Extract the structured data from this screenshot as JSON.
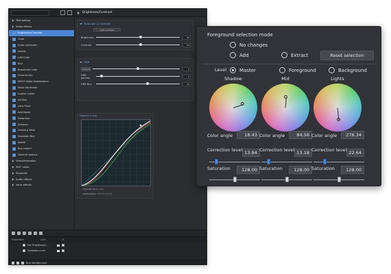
{
  "sidebar": {
    "items": [
      {
        "label": "Title editing",
        "icon": "arrow",
        "selected": false
      },
      {
        "label": "Video effects",
        "icon": "arrow",
        "selected": false
      },
      {
        "label": "Brightness/Contrast",
        "icon": "fx",
        "selected": true
      },
      {
        "label": "Color",
        "icon": "fx",
        "selected": false
      },
      {
        "label": "Color correction",
        "icon": "fx",
        "selected": false
      },
      {
        "label": "Levels",
        "icon": "fx",
        "selected": false
      },
      {
        "label": "LAB Color",
        "icon": "fx",
        "selected": false
      },
      {
        "label": "Blur",
        "icon": "fx",
        "selected": false
      },
      {
        "label": "Broadcast Color",
        "icon": "fx",
        "selected": false
      },
      {
        "label": "Chroma key",
        "icon": "fx",
        "selected": false
      },
      {
        "label": "MSU3 Video Stabilization",
        "icon": "fx",
        "selected": false
      },
      {
        "label": "Mask Generator",
        "icon": "fx",
        "selected": false
      },
      {
        "label": "Cookie Cutter",
        "icon": "fx",
        "selected": false
      },
      {
        "label": "Art Blur",
        "icon": "fx",
        "selected": false
      },
      {
        "label": "Lens Flare",
        "icon": "fx",
        "selected": false
      },
      {
        "label": "Add Noise",
        "icon": "fx",
        "selected": false
      },
      {
        "label": "Distortion",
        "icon": "fx",
        "selected": false
      },
      {
        "label": "Sharpen",
        "icon": "fx",
        "selected": false
      },
      {
        "label": "Unsharp Mask",
        "icon": "fx",
        "selected": false
      },
      {
        "label": "Gaussian Blur",
        "icon": "fx",
        "selected": false
      },
      {
        "label": "Speed",
        "icon": "fx",
        "selected": false
      },
      {
        "label": "Blur match",
        "icon": "fx",
        "selected": false
      },
      {
        "label": "General options",
        "icon": "fx",
        "selected": false
      },
      {
        "label": "Video/Animation",
        "icon": "arrow",
        "selected": false
      },
      {
        "label": "360° video",
        "icon": "arrow",
        "selected": false
      },
      {
        "label": "Stereo3D",
        "icon": "arrow",
        "selected": false
      },
      {
        "label": "Audio effects",
        "icon": "arrow",
        "selected": false
      },
      {
        "label": "Voice effects",
        "icon": "arrow",
        "selected": false
      }
    ]
  },
  "right_panel": {
    "header": "Brightness/Contrast",
    "group1": {
      "title": "Tint/Light & Contrast",
      "auto_button": "Auto contrast",
      "rows": [
        {
          "label": "Brightness",
          "value": "50",
          "level": 0.52
        },
        {
          "label": "Contrast",
          "value": "50",
          "level": 0.52
        }
      ]
    },
    "group2": {
      "title": "HDR",
      "dropdown": "Gamma",
      "rows": [
        {
          "label": "HDR gamma",
          "value": "0",
          "level": 0.05
        },
        {
          "label": "HDR Blur",
          "value": "50",
          "level": 0.6
        }
      ]
    },
    "curve": {
      "title": "Gamma Curve",
      "ctrl1": "Channel: All   ▾  □  Lin",
      "ctrl2": "Interpolation: ▭▭   ▭ ▭  □ □"
    }
  },
  "bottom": {
    "columns": [
      "Parameters",
      "Lock",
      "D"
    ],
    "rows": [
      {
        "label": "Set: Brightness/C..."
      },
      {
        "label": "Gradation curve"
      }
    ],
    "footer": "Blue Starlight.mp4"
  },
  "popup": {
    "title": "Foreground selection mode",
    "mode_options": [
      {
        "label": "No changes",
        "checked": false
      },
      {
        "label": "Add",
        "checked": false
      },
      {
        "label": "Extract",
        "checked": false
      }
    ],
    "reset_button": "Reset selection",
    "level_label": "Level",
    "level_options": [
      {
        "label": "Master",
        "checked": true
      },
      {
        "label": "Foreground",
        "checked": false
      },
      {
        "label": "Background",
        "checked": false
      }
    ],
    "wheels": [
      {
        "title": "Shadow",
        "color_angle": "18.43",
        "correction_level": "13.84",
        "saturation": "128.00",
        "correction_fraction": 0.12,
        "saturation_fraction": 0.5
      },
      {
        "title": "Mid",
        "color_angle": "84.56",
        "correction_level": "13.18",
        "saturation": "128.00",
        "correction_fraction": 0.12,
        "saturation_fraction": 0.5
      },
      {
        "title": "Lights",
        "color_angle": "276.34",
        "correction_level": "22.64",
        "saturation": "128.00",
        "correction_fraction": 0.2,
        "saturation_fraction": 0.5
      }
    ],
    "labels": {
      "color_angle": "Color angle",
      "correction_level": "Correction level",
      "saturation": "Saturation"
    }
  }
}
